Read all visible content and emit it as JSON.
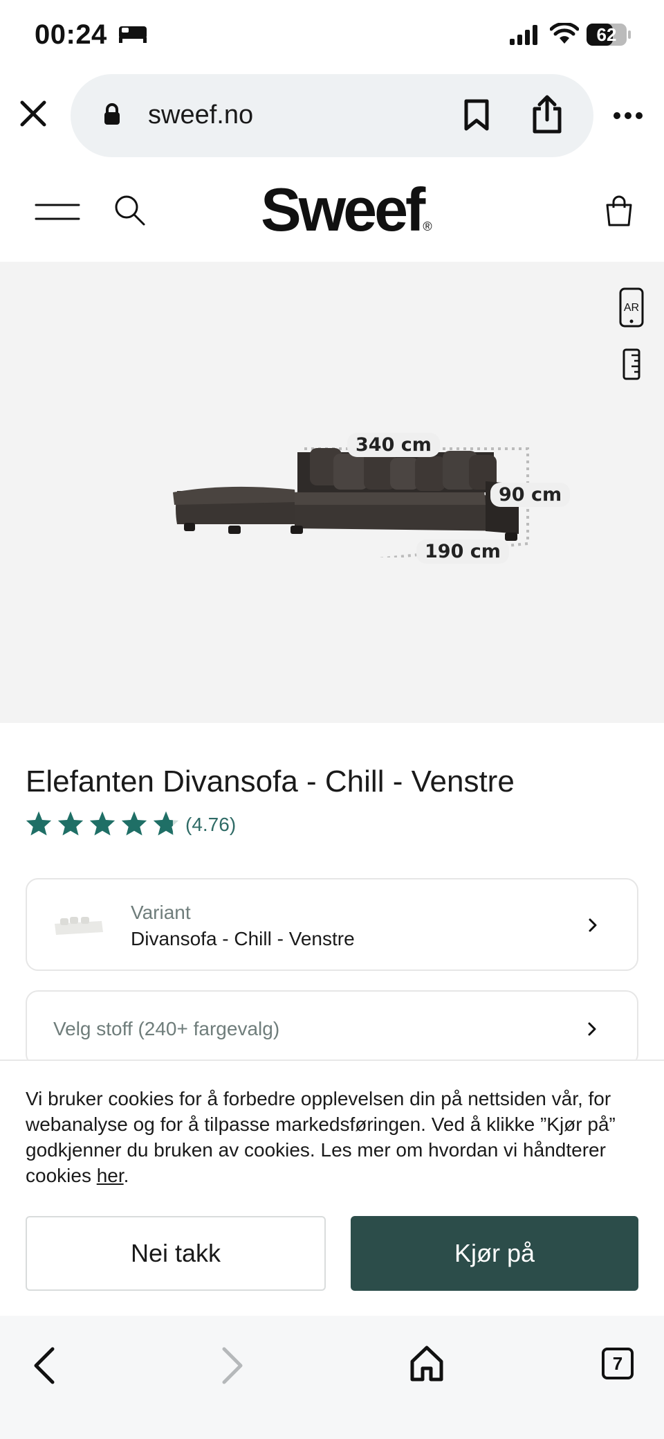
{
  "status_bar": {
    "time": "00:24",
    "battery": "62"
  },
  "browser": {
    "url": "sweef.no"
  },
  "site": {
    "logo": "Sweef",
    "logo_mark": "®"
  },
  "hero": {
    "dimensions": {
      "width": "340 cm",
      "height": "90 cm",
      "depth": "190 cm"
    },
    "ar_label": "AR"
  },
  "product": {
    "title": "Elefanten Divansofa - Chill - Venstre",
    "rating": "(4.76)",
    "variant": {
      "label": "Variant",
      "value": "Divansofa - Chill - Venstre"
    },
    "fabric": {
      "label": "Velg stoff (240+ fargevalg)"
    }
  },
  "cookie_banner": {
    "text": "Vi bruker cookies for å forbedre opplevelsen din på nettsiden vår, for webanalyse og for å tilpasse markedsføringen. Ved å klikke ”Kjør på” godkjenner du bruken av cookies. Les mer om hvordan vi håndterer cookies ",
    "link": "her",
    "end": ".",
    "decline": "Nei takk",
    "accept": "Kjør på"
  },
  "toolbar": {
    "tab_count": "7"
  },
  "colors": {
    "accent": "#2c4d4a",
    "star": "#1f6f66",
    "hero_bg": "#f3f3f3"
  }
}
